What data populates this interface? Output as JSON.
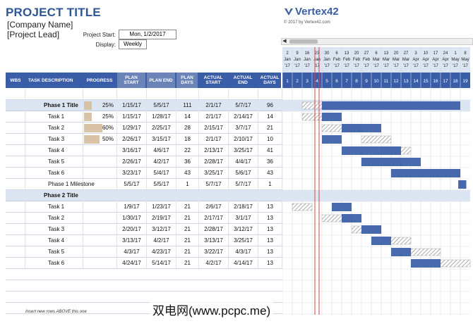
{
  "header": {
    "title": "PROJECT TITLE",
    "company": "[Company Name]",
    "lead": "[Project Lead]",
    "project_start_label": "Project Start:",
    "project_start_value": "Mon, 1/2/2017",
    "display_label": "Display:",
    "display_value": "Weekly",
    "logo": "Vertex42",
    "copyright": "© 2017 by Vertex42.com"
  },
  "colors": {
    "header_blue": "#3a5da8",
    "bar_blue": "#3a5da8",
    "phase_bg": "#dce6f2",
    "progress": "#d9c3a7",
    "today_line": "#d9434a"
  },
  "columns": [
    "WBS",
    "TASK DESCRIPTION",
    "PROGRESS",
    "PLAN START",
    "PLAN END",
    "PLAN DAYS",
    "ACTUAL START",
    "ACTUAL END",
    "ACTUAL DAYS"
  ],
  "rows": [
    {
      "wbs": "",
      "task": "",
      "progress": "",
      "ps": "",
      "pe": "",
      "pd": "",
      "as": "",
      "ae": "",
      "ad": "",
      "type": "blank"
    },
    {
      "wbs": "",
      "task": "Phase 1 Title",
      "progress": "25%",
      "ps": "1/15/17",
      "pe": "5/5/17",
      "pd": "111",
      "as": "2/1/17",
      "ae": "5/7/17",
      "ad": "96",
      "type": "phase"
    },
    {
      "wbs": "",
      "task": "Task 1",
      "progress": "25%",
      "ps": "1/15/17",
      "pe": "1/28/17",
      "pd": "14",
      "as": "2/1/17",
      "ae": "2/14/17",
      "ad": "14",
      "type": "task"
    },
    {
      "wbs": "",
      "task": "Task 2",
      "progress": "60%",
      "ps": "1/29/17",
      "pe": "2/25/17",
      "pd": "28",
      "as": "2/15/17",
      "ae": "3/7/17",
      "ad": "21",
      "type": "task"
    },
    {
      "wbs": "",
      "task": "Task 3",
      "progress": "50%",
      "ps": "2/26/17",
      "pe": "3/15/17",
      "pd": "18",
      "as": "2/1/17",
      "ae": "2/10/17",
      "ad": "10",
      "type": "task"
    },
    {
      "wbs": "",
      "task": "Task 4",
      "progress": "",
      "ps": "3/16/17",
      "pe": "4/6/17",
      "pd": "22",
      "as": "2/13/17",
      "ae": "3/25/17",
      "ad": "41",
      "type": "task"
    },
    {
      "wbs": "",
      "task": "Task 5",
      "progress": "",
      "ps": "2/26/17",
      "pe": "4/2/17",
      "pd": "36",
      "as": "2/28/17",
      "ae": "4/4/17",
      "ad": "36",
      "type": "task"
    },
    {
      "wbs": "",
      "task": "Task 6",
      "progress": "",
      "ps": "3/23/17",
      "pe": "5/4/17",
      "pd": "43",
      "as": "3/25/17",
      "ae": "5/6/17",
      "ad": "43",
      "type": "task"
    },
    {
      "wbs": "",
      "task": "Phase 1 Milestone",
      "progress": "",
      "ps": "5/5/17",
      "pe": "5/5/17",
      "pd": "1",
      "as": "5/7/17",
      "ae": "5/7/17",
      "ad": "1",
      "type": "task"
    },
    {
      "wbs": "",
      "task": "Phase 2 Title",
      "progress": "",
      "ps": "",
      "pe": "",
      "pd": "",
      "as": "",
      "ae": "",
      "ad": "",
      "type": "phase"
    },
    {
      "wbs": "",
      "task": "Task 1",
      "progress": "",
      "ps": "1/9/17",
      "pe": "1/23/17",
      "pd": "21",
      "as": "2/6/17",
      "ae": "2/18/17",
      "ad": "13",
      "type": "task"
    },
    {
      "wbs": "",
      "task": "Task 2",
      "progress": "",
      "ps": "1/30/17",
      "pe": "2/19/17",
      "pd": "21",
      "as": "2/17/17",
      "ae": "3/1/17",
      "ad": "13",
      "type": "task"
    },
    {
      "wbs": "",
      "task": "Task 3",
      "progress": "",
      "ps": "2/20/17",
      "pe": "3/12/17",
      "pd": "21",
      "as": "2/28/17",
      "ae": "3/12/17",
      "ad": "13",
      "type": "task"
    },
    {
      "wbs": "",
      "task": "Task 4",
      "progress": "",
      "ps": "3/13/17",
      "pe": "4/2/17",
      "pd": "21",
      "as": "3/13/17",
      "ae": "3/25/17",
      "ad": "13",
      "type": "task"
    },
    {
      "wbs": "",
      "task": "Task 5",
      "progress": "",
      "ps": "4/3/17",
      "pe": "4/23/17",
      "pd": "21",
      "as": "3/22/17",
      "ae": "4/3/17",
      "ad": "13",
      "type": "task"
    },
    {
      "wbs": "",
      "task": "Task 6",
      "progress": "",
      "ps": "4/24/17",
      "pe": "5/14/17",
      "pd": "21",
      "as": "4/2/17",
      "ae": "4/14/17",
      "ad": "13",
      "type": "task"
    }
  ],
  "progress_values": [
    0,
    0.25,
    0.25,
    0.6,
    0.5,
    0,
    0,
    0,
    0,
    0,
    0,
    0,
    0,
    0,
    0,
    0
  ],
  "insert_note": "Insert new rows ABOVE this one",
  "timeline": {
    "weeks": [
      {
        "day": "2",
        "mon": "Jan",
        "yr": "'17"
      },
      {
        "day": "9",
        "mon": "Jan",
        "yr": "'17"
      },
      {
        "day": "16",
        "mon": "Jan",
        "yr": "'17"
      },
      {
        "day": "23",
        "mon": "Jan",
        "yr": "'17"
      },
      {
        "day": "30",
        "mon": "Jan",
        "yr": "'17"
      },
      {
        "day": "6",
        "mon": "Feb",
        "yr": "'17"
      },
      {
        "day": "13",
        "mon": "Feb",
        "yr": "'17"
      },
      {
        "day": "20",
        "mon": "Feb",
        "yr": "'17"
      },
      {
        "day": "27",
        "mon": "Feb",
        "yr": "'17"
      },
      {
        "day": "6",
        "mon": "Mar",
        "yr": "'17"
      },
      {
        "day": "13",
        "mon": "Mar",
        "yr": "'17"
      },
      {
        "day": "20",
        "mon": "Mar",
        "yr": "'17"
      },
      {
        "day": "27",
        "mon": "Mar",
        "yr": "'17"
      },
      {
        "day": "3",
        "mon": "Apr",
        "yr": "'17"
      },
      {
        "day": "10",
        "mon": "Apr",
        "yr": "'17"
      },
      {
        "day": "17",
        "mon": "Apr",
        "yr": "'17"
      },
      {
        "day": "24",
        "mon": "Apr",
        "yr": "'17"
      },
      {
        "day": "1",
        "mon": "May",
        "yr": "'17"
      },
      {
        "day": "8",
        "mon": "May",
        "yr": "'17"
      }
    ],
    "week_numbers": [
      "1",
      "2",
      "3",
      "4",
      "5",
      "6",
      "7",
      "8",
      "9",
      "10",
      "11",
      "12",
      "13",
      "14",
      "15",
      "16",
      "17",
      "18",
      "19"
    ]
  },
  "gantt_bars": [
    {
      "row": 1,
      "plan": [
        2,
        4
      ],
      "actual": [
        4,
        18
      ]
    },
    {
      "row": 2,
      "plan": [
        2,
        4
      ],
      "actual": [
        4,
        6
      ]
    },
    {
      "row": 3,
      "plan": [
        4,
        8
      ],
      "actual": [
        6,
        10
      ]
    },
    {
      "row": 4,
      "plan": [
        8,
        11
      ],
      "actual": [
        4,
        6
      ]
    },
    {
      "row": 5,
      "plan": [
        10,
        13
      ],
      "actual": [
        6,
        12
      ]
    },
    {
      "row": 6,
      "plan": [
        8,
        12
      ],
      "actual": [
        8,
        14
      ]
    },
    {
      "row": 7,
      "plan": [
        11,
        18
      ],
      "actual": [
        11,
        18
      ]
    },
    {
      "row": 8,
      "plan": [
        17.8,
        18.6
      ],
      "actual": [
        17.8,
        18.6
      ]
    },
    {
      "row": 10,
      "plan": [
        1,
        3
      ],
      "actual": [
        5,
        7
      ]
    },
    {
      "row": 11,
      "plan": [
        4,
        7
      ],
      "actual": [
        6,
        8
      ]
    },
    {
      "row": 12,
      "plan": [
        7,
        10
      ],
      "actual": [
        8,
        10
      ]
    },
    {
      "row": 13,
      "plan": [
        10,
        13
      ],
      "actual": [
        9,
        11
      ]
    },
    {
      "row": 14,
      "plan": [
        13,
        16
      ],
      "actual": [
        11,
        13
      ]
    },
    {
      "row": 15,
      "plan": [
        16,
        19
      ],
      "actual": [
        13,
        16
      ]
    }
  ],
  "today_week": 3.5,
  "watermark": "双电网(www.pcpc.me)"
}
